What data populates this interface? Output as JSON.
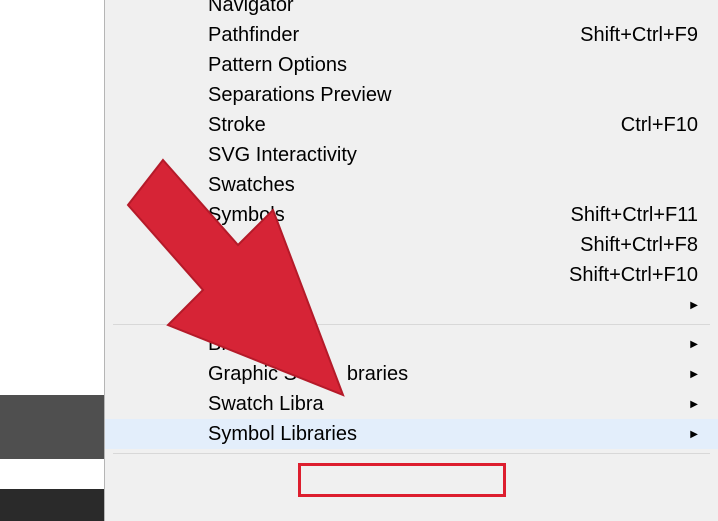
{
  "menu": {
    "items": [
      {
        "label": "Navigator",
        "shortcut": "",
        "submenu": false
      },
      {
        "label": "Pathfinder",
        "shortcut": "Shift+Ctrl+F9",
        "submenu": false
      },
      {
        "label": "Pattern Options",
        "shortcut": "",
        "submenu": false
      },
      {
        "label": "Separations Preview",
        "shortcut": "",
        "submenu": false
      },
      {
        "label": "Stroke",
        "shortcut": "Ctrl+F10",
        "submenu": false
      },
      {
        "label": "SVG Interactivity",
        "shortcut": "",
        "submenu": false
      },
      {
        "label": "Swatches",
        "shortcut": "",
        "submenu": false
      },
      {
        "label": "Symbols",
        "shortcut": "Shift+Ctrl+F11",
        "submenu": false
      },
      {
        "label": "",
        "shortcut": "Shift+Ctrl+F8",
        "submenu": false
      },
      {
        "label": "",
        "shortcut": "Shift+Ctrl+F10",
        "submenu": false
      },
      {
        "label": "",
        "shortcut": "",
        "submenu": true
      },
      {
        "label": "Brus",
        "shortcut": "",
        "submenu": true
      },
      {
        "label": "Graphic S         braries",
        "shortcut": "",
        "submenu": true
      },
      {
        "label": "Swatch Libra",
        "shortcut": "",
        "submenu": true
      },
      {
        "label": "Symbol Libraries",
        "shortcut": "",
        "submenu": true,
        "highlight": true
      }
    ]
  },
  "annotation": {
    "arrow_color": "#d62436"
  }
}
